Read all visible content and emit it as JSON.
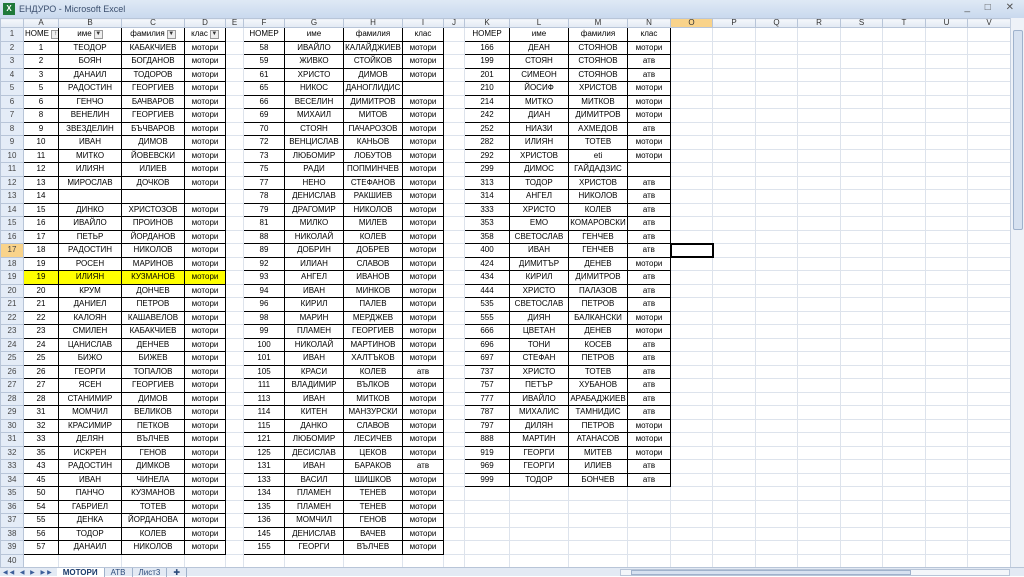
{
  "window": {
    "title": "ЕНДУРО - Microsoft Excel",
    "app_icon": "excel-icon"
  },
  "columns": [
    "A",
    "B",
    "C",
    "D",
    "E",
    "F",
    "G",
    "H",
    "I",
    "J",
    "K",
    "L",
    "M",
    "N",
    "O",
    "P",
    "Q",
    "R",
    "S",
    "T",
    "U",
    "V"
  ],
  "selected_cell": "O17",
  "highlight_color": "#ffff00",
  "tables": [
    {
      "header": [
        "НОМЕ",
        "име",
        "фамилия",
        "клас"
      ],
      "rows": [
        [
          "1",
          "ТЕОДОР",
          "КАБАКЧИЕВ",
          "мотори"
        ],
        [
          "2",
          "БОЯН",
          "БОГДАНОВ",
          "мотори"
        ],
        [
          "3",
          "ДАНАИЛ",
          "ТОДОРОВ",
          "мотори"
        ],
        [
          "5",
          "РАДОСТИН",
          "ГЕОРГИЕВ",
          "мотори"
        ],
        [
          "6",
          "ГЕНЧО",
          "БАЧВАРОВ",
          "мотори"
        ],
        [
          "8",
          "ВЕНЕЛИН",
          "ГЕОРГИЕВ",
          "мотори"
        ],
        [
          "9",
          "ЗВЕЗДЕЛИН",
          "БЪЧВАРОВ",
          "мотори"
        ],
        [
          "10",
          "ИВАН",
          "ДИМОВ",
          "мотори"
        ],
        [
          "11",
          "МИТКО",
          "ЙОВЕВСКИ",
          "мотори"
        ],
        [
          "12",
          "ИЛИЯН",
          "ИЛИЕВ",
          "мотори"
        ],
        [
          "13",
          "МИРОСЛАВ",
          "ДОЧКОВ",
          "мотори"
        ],
        [
          "14",
          "",
          "",
          ""
        ],
        [
          "15",
          "ДИНКО",
          "ХРИСТОЗОВ",
          "мотори"
        ],
        [
          "16",
          "ИВАЙЛО",
          "ПРОИНОВ",
          "мотори"
        ],
        [
          "17",
          "ПЕТЬР",
          "ЙОРДАНОВ",
          "мотори"
        ],
        [
          "18",
          "РАДОСТИН",
          "НИКОЛОВ",
          "мотори"
        ],
        [
          "19",
          "РОСЕН",
          "МАРИНОВ",
          "мотори"
        ],
        [
          "19",
          "ИЛИЯН",
          "КУЗМАНОВ",
          "мотори"
        ],
        [
          "20",
          "КРУМ",
          "ДОНЧЕВ",
          "мотори"
        ],
        [
          "21",
          "ДАНИЕЛ",
          "ПЕТРОВ",
          "мотори"
        ],
        [
          "22",
          "КАЛОЯН",
          "КАШАВЕЛОВ",
          "мотори"
        ],
        [
          "23",
          "СМИЛЕН",
          "КАБАКЧИЕВ",
          "мотори"
        ],
        [
          "24",
          "ЦАНИСЛАВ",
          "ДЕНЧЕВ",
          "мотори"
        ],
        [
          "25",
          "БИЖО",
          "БИЖЕВ",
          "мотори"
        ],
        [
          "26",
          "ГЕОРГИ",
          "ТОПАЛОВ",
          "мотори"
        ],
        [
          "27",
          "ЯСЕН",
          "ГЕОРГИЕВ",
          "мотори"
        ],
        [
          "28",
          "СТАНИМИР",
          "ДИМОВ",
          "мотори"
        ],
        [
          "31",
          "МОМЧИЛ",
          "ВЕЛИКОВ",
          "мотори"
        ],
        [
          "32",
          "КРАСИМИР",
          "ПЕТКОВ",
          "мотори"
        ],
        [
          "33",
          "ДЕЛЯН",
          "ВЪЛЧЕВ",
          "мотори"
        ],
        [
          "35",
          "ИСКРЕН",
          "ГЕНОВ",
          "мотори"
        ],
        [
          "43",
          "РАДОСТИН",
          "ДИМКОВ",
          "мотори"
        ],
        [
          "45",
          "ИВАН",
          "ЧИНЕЛА",
          "мотори"
        ],
        [
          "50",
          "ПАНЧО",
          "КУЗМАНОВ",
          "мотори"
        ],
        [
          "54",
          "ГАБРИЕЛ",
          "ТОТЕВ",
          "мотори"
        ],
        [
          "55",
          "ДЕНКА",
          "ЙОРДАНОВА",
          "мотори"
        ],
        [
          "56",
          "ТОДОР",
          "КОЛЕВ",
          "мотори"
        ],
        [
          "57",
          "ДАНАИЛ",
          "НИКОЛОВ",
          "мотори"
        ]
      ]
    },
    {
      "header": [
        "НОМЕР",
        "име",
        "фамилия",
        "клас"
      ],
      "rows": [
        [
          "58",
          "ИВАЙЛО",
          "КАЛАЙДЖИЕВ",
          "мотори"
        ],
        [
          "59",
          "ЖИВКО",
          "СТОЙКОВ",
          "мотори"
        ],
        [
          "61",
          "ХРИСТО",
          "ДИМОВ",
          "мотори"
        ],
        [
          "65",
          "НИКОС",
          "ДАНОГЛИДИС",
          ""
        ],
        [
          "66",
          "ВЕСЕЛИН",
          "ДИМИТРОВ",
          "мотори"
        ],
        [
          "69",
          "МИХАИЛ",
          "МИТОВ",
          "мотори"
        ],
        [
          "70",
          "СТОЯН",
          "ПАЧАРОЗОВ",
          "мотори"
        ],
        [
          "72",
          "ВЕНЦИСЛАВ",
          "КАНЬОВ",
          "мотори"
        ],
        [
          "73",
          "ЛЮБОМИР",
          "ЛОБУТОВ",
          "мотори"
        ],
        [
          "75",
          "РАДИ",
          "ПОПМИНЧЕВ",
          "мотори"
        ],
        [
          "77",
          "НЕНО",
          "СТЕФАНОВ",
          "мотори"
        ],
        [
          "78",
          "ДЕНИСЛАВ",
          "РАКШИЕВ",
          "мотори"
        ],
        [
          "79",
          "ДРАГОМИР",
          "НИКОЛОВ",
          "мотори"
        ],
        [
          "81",
          "МИЛКО",
          "МИЛЕВ",
          "мотори"
        ],
        [
          "88",
          "НИКОЛАЙ",
          "КОЛЕВ",
          "мотори"
        ],
        [
          "89",
          "ДОБРИН",
          "ДОБРЕВ",
          "мотори"
        ],
        [
          "92",
          "ИЛИАН",
          "СЛАВОВ",
          "мотори"
        ],
        [
          "93",
          "АНГЕЛ",
          "ИВАНОВ",
          "мотори"
        ],
        [
          "94",
          "ИВАН",
          "МИНКОВ",
          "мотори"
        ],
        [
          "96",
          "КИРИЛ",
          "ПАЛЕВ",
          "мотори"
        ],
        [
          "98",
          "МАРИН",
          "МЕРДЖЕВ",
          "мотори"
        ],
        [
          "99",
          "ПЛАМЕН",
          "ГЕОРГИЕВ",
          "мотори"
        ],
        [
          "100",
          "НИКОЛАЙ",
          "МАРТИНОВ",
          "мотори"
        ],
        [
          "101",
          "ИВАН",
          "ХАЛТЪКОВ",
          "мотори"
        ],
        [
          "105",
          "КРАСИ",
          "КОЛЕВ",
          "атв"
        ],
        [
          "111",
          "ВЛАДИМИР",
          "ВЪЛКОВ",
          "мотори"
        ],
        [
          "113",
          "ИВАН",
          "МИТКОВ",
          "мотори"
        ],
        [
          "114",
          "КИТЕН",
          "МАНЗУРСКИ",
          "мотори"
        ],
        [
          "115",
          "ДАНКО",
          "СЛАВОВ",
          "мотори"
        ],
        [
          "121",
          "ЛЮБОМИР",
          "ЛЕСИЧЕВ",
          "мотори"
        ],
        [
          "125",
          "ДЕСИСЛАВ",
          "ЦЕКОВ",
          "мотори"
        ],
        [
          "131",
          "ИВАН",
          "БАРАКОВ",
          "атв"
        ],
        [
          "133",
          "ВАСИЛ",
          "ШИШКОВ",
          "мотори"
        ],
        [
          "134",
          "ПЛАМЕН",
          "ТЕНЕВ",
          "мотори"
        ],
        [
          "135",
          "ПЛАМЕН",
          "ТЕНЕВ",
          "мотори"
        ],
        [
          "136",
          "МОМЧИЛ",
          "ГЕНОВ",
          "мотори"
        ],
        [
          "145",
          "ДЕНИСЛАВ",
          "ВАЧЕВ",
          "мотори"
        ],
        [
          "155",
          "ГЕОРГИ",
          "ВЪЛЧЕВ",
          "мотори"
        ]
      ]
    },
    {
      "header": [
        "НОМЕР",
        "име",
        "фамилия",
        "клас"
      ],
      "rows": [
        [
          "166",
          "ДЕАН",
          "СТОЯНОВ",
          "мотори"
        ],
        [
          "199",
          "СТОЯН",
          "СТОЯНОВ",
          "атв"
        ],
        [
          "201",
          "СИМЕОН",
          "СТОЯНОВ",
          "атв"
        ],
        [
          "210",
          "ЙОСИФ",
          "ХРИСТОВ",
          "мотори"
        ],
        [
          "214",
          "МИТКО",
          "МИТКОВ",
          "мотори"
        ],
        [
          "242",
          "ДИАН",
          "ДИМИТРОВ",
          "мотори"
        ],
        [
          "252",
          "НИАЗИ",
          "АХМЕДОВ",
          "атв"
        ],
        [
          "282",
          "ИЛИЯН",
          "ТОТЕВ",
          "мотори"
        ],
        [
          "292",
          "ХРИСТОВ",
          "eti",
          "мотори"
        ],
        [
          "299",
          "ДИМОС",
          "ГАЙДАДЗИС",
          ""
        ],
        [
          "313",
          "ТОДОР",
          "ХРИСТОВ",
          "атв"
        ],
        [
          "314",
          "АНГЕЛ",
          "НИКОЛОВ",
          "атв"
        ],
        [
          "333",
          "ХРИСТО",
          "КОЛЕВ",
          "атв"
        ],
        [
          "353",
          "ЕМО",
          "КОМАРОВСКИ",
          "атв"
        ],
        [
          "358",
          "СВЕТОСЛАВ",
          "ГЕНЧЕВ",
          "атв"
        ],
        [
          "400",
          "ИВАН",
          "ГЕНЧЕВ",
          "атв"
        ],
        [
          "424",
          "ДИМИТЪР",
          "ДЕНЕВ",
          "мотори"
        ],
        [
          "434",
          "КИРИЛ",
          "ДИМИТРОВ",
          "атв"
        ],
        [
          "444",
          "ХРИСТО",
          "ПАЛАЗОВ",
          "атв"
        ],
        [
          "535",
          "СВЕТОСЛАВ",
          "ПЕТРОВ",
          "атв"
        ],
        [
          "555",
          "ДИЯН",
          "БАЛКАНСКИ",
          "мотори"
        ],
        [
          "666",
          "ЦВЕТАН",
          "ДЕНЕВ",
          "мотори"
        ],
        [
          "696",
          "ТОНИ",
          "КОСЕВ",
          "атв"
        ],
        [
          "697",
          "СТЕФАН",
          "ПЕТРОВ",
          "атв"
        ],
        [
          "737",
          "ХРИСТО",
          "ТОТЕВ",
          "атв"
        ],
        [
          "757",
          "ПЕТЪР",
          "ХУБАНОВ",
          "атв"
        ],
        [
          "777",
          "ИВАЙЛО",
          "АРАБАДЖИЕВ",
          "атв"
        ],
        [
          "787",
          "МИХАЛИС",
          "ТАМНИДИС",
          "атв"
        ],
        [
          "797",
          "ДИЛЯН",
          "ПЕТРОВ",
          "мотори"
        ],
        [
          "888",
          "МАРТИН",
          "АТАНАСОВ",
          "мотори"
        ],
        [
          "919",
          "ГЕОРГИ",
          "МИТЕВ",
          "мотори"
        ],
        [
          "969",
          "ГЕОРГИ",
          "ИЛИЕВ",
          "атв"
        ],
        [
          "999",
          "ТОДОР",
          "БОНЧЕВ",
          "атв"
        ]
      ]
    }
  ],
  "sheet_tabs": [
    "МОТОРИ",
    "АТВ",
    "Лист3"
  ],
  "active_tab": "МОТОРИ"
}
